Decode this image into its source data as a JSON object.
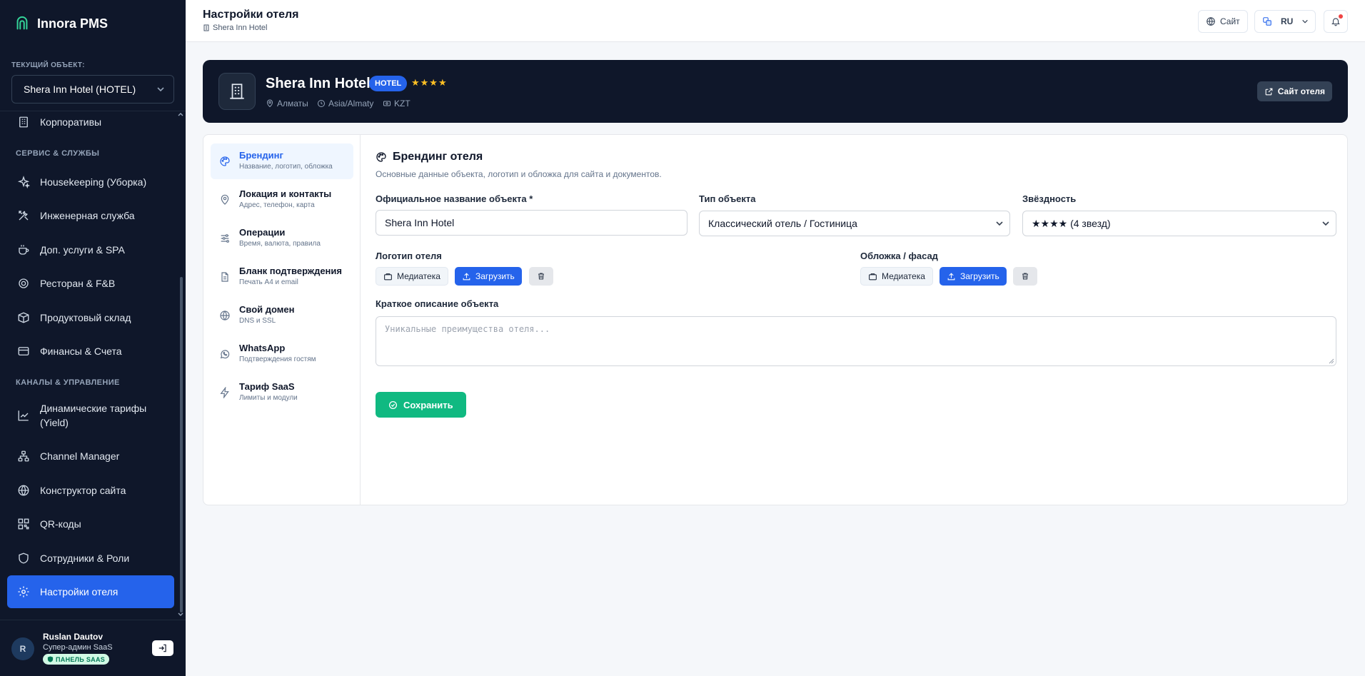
{
  "app": {
    "name": "Innora PMS"
  },
  "sidebar": {
    "current_object_label": "ТЕКУЩИЙ ОБЪЕКТ:",
    "current_object_value": "Shera Inn Hotel (HOTEL)",
    "items": [
      {
        "label": "Корпоративы",
        "icon": "building-icon"
      },
      {
        "section": "СЕРВИС & СЛУЖБЫ"
      },
      {
        "label": "Housekeeping (Уборка)",
        "icon": "sparkles-icon"
      },
      {
        "label": "Инженерная служба",
        "icon": "tools-icon"
      },
      {
        "label": "Доп. услуги & SPA",
        "icon": "cup-icon"
      },
      {
        "label": "Ресторан & F&B",
        "icon": "food-icon"
      },
      {
        "label": "Продуктовый склад",
        "icon": "box-icon"
      },
      {
        "label": "Финансы & Счета",
        "icon": "card-icon"
      },
      {
        "section": "КАНАЛЫ & УПРАВЛЕНИЕ"
      },
      {
        "label": "Динамические тарифы (Yield)",
        "icon": "trend-icon"
      },
      {
        "label": "Channel Manager",
        "icon": "network-icon"
      },
      {
        "label": "Конструктор сайта",
        "icon": "globe-icon"
      },
      {
        "label": "QR-коды",
        "icon": "qr-icon"
      },
      {
        "label": "Сотрудники & Роли",
        "icon": "shield-icon"
      },
      {
        "label": "Настройки отеля",
        "icon": "gear-icon",
        "active": true
      }
    ],
    "user": {
      "initial": "R",
      "name": "Ruslan Dautov",
      "role": "Супер-админ SaaS",
      "badge": "ПАНЕЛЬ SAAS"
    }
  },
  "header": {
    "title": "Настройки отеля",
    "subtitle": "Shera Inn Hotel",
    "site_button": "Сайт",
    "language": "RU"
  },
  "hotel": {
    "name": "Shera Inn Hotel",
    "type_badge": "HOTEL",
    "stars": "★★★★",
    "city": "Алматы",
    "timezone": "Asia/Almaty",
    "currency": "KZT",
    "site_button": "Сайт отеля"
  },
  "settings_nav": [
    {
      "title": "Брендинг",
      "subtitle": "Название, логотип, обложка",
      "icon": "palette-icon",
      "active": true
    },
    {
      "title": "Локация и контакты",
      "subtitle": "Адрес, телефон, карта",
      "icon": "map-pin-icon"
    },
    {
      "title": "Операции",
      "subtitle": "Время, валюта, правила",
      "icon": "sliders-icon"
    },
    {
      "title": "Бланк подтверждения",
      "subtitle": "Печать А4 и email",
      "icon": "document-icon"
    },
    {
      "title": "Свой домен",
      "subtitle": "DNS и SSL",
      "icon": "globe-icon"
    },
    {
      "title": "WhatsApp",
      "subtitle": "Подтверждения гостям",
      "icon": "whatsapp-icon"
    },
    {
      "title": "Тариф SaaS",
      "subtitle": "Лимиты и модули",
      "icon": "bolt-icon"
    }
  ],
  "branding": {
    "title": "Брендинг отеля",
    "description": "Основные данные объекта, логотип и обложка для сайта и документов.",
    "name_label": "Официальное название объекта *",
    "name_value": "Shera Inn Hotel",
    "type_label": "Тип объекта",
    "type_value": "Классический отель / Гостиница",
    "stars_label": "Звёздность",
    "stars_value": "★★★★ (4 звезд)",
    "logo_label": "Логотип отеля",
    "cover_label": "Обложка / фасад",
    "media_button": "Медиатека",
    "upload_button": "Загрузить",
    "desc_label": "Краткое описание объекта",
    "desc_placeholder": "Уникальные преимущества отеля...",
    "save_button": "Сохранить"
  },
  "colors": {
    "primary": "#2563eb",
    "success": "#10b981",
    "sidebar_bg": "#0f172a",
    "star": "#fbbf24"
  }
}
